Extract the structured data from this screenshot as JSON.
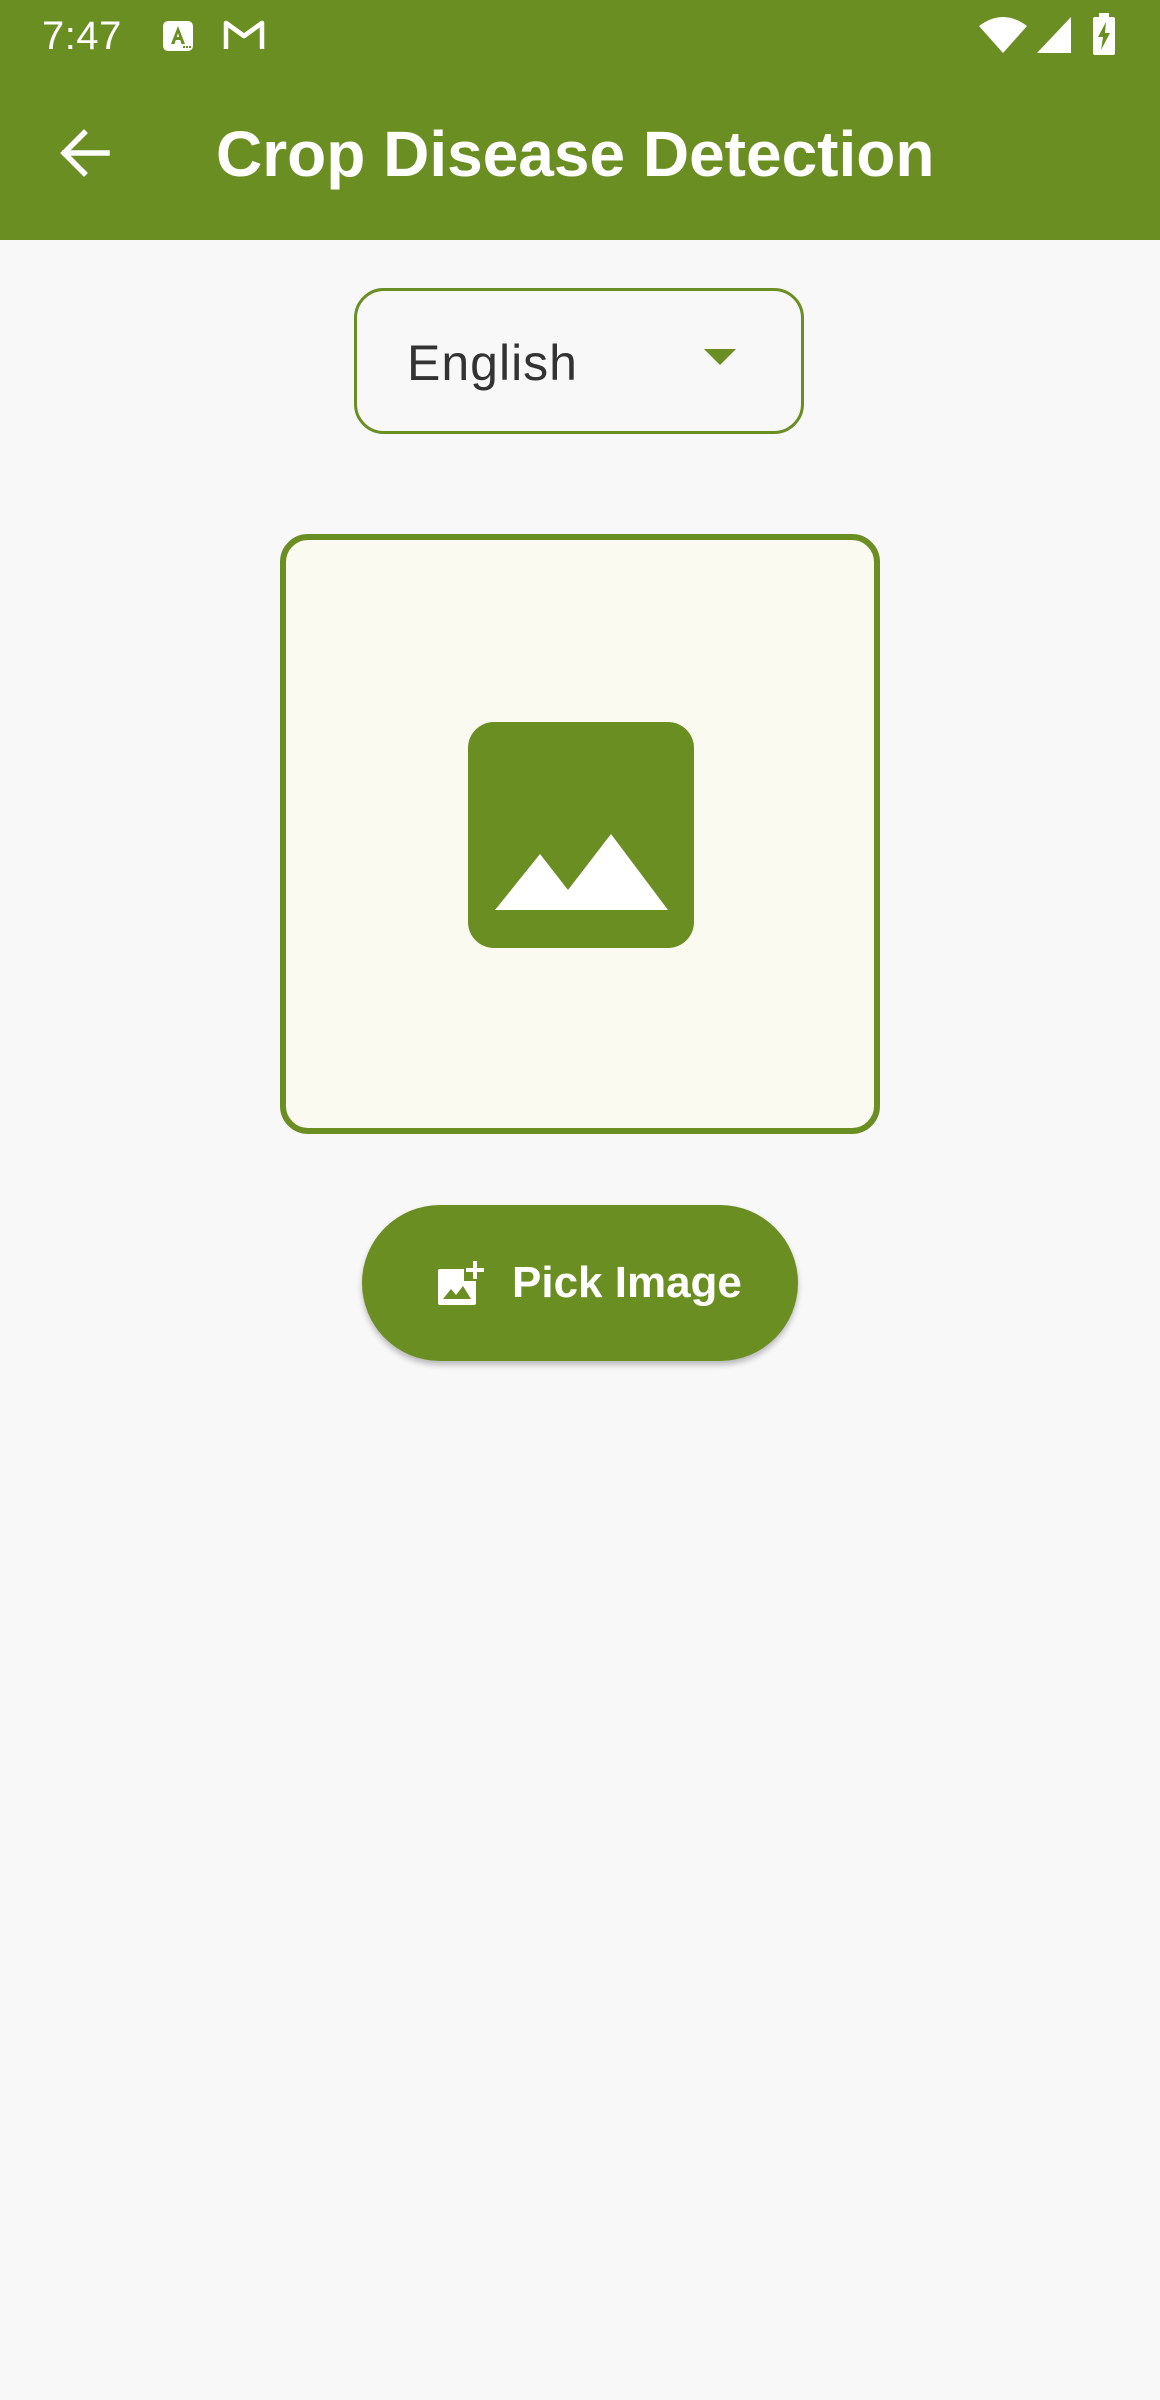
{
  "status_bar": {
    "time": "7:47",
    "left_icons": [
      "translate-icon",
      "gmail-icon"
    ],
    "right_icons": [
      "wifi-icon",
      "cell-signal-icon",
      "battery-charging-icon"
    ]
  },
  "app_bar": {
    "title": "Crop Disease Detection",
    "back_icon": "arrow-back-icon",
    "background_color": "#6b8e23"
  },
  "language_selector": {
    "selected": "English",
    "icon": "dropdown-arrow-icon"
  },
  "image_preview": {
    "placeholder_icon": "image-placeholder-icon",
    "background_color": "#fafaf0"
  },
  "pick_image_button": {
    "label": "Pick Image",
    "icon": "add-photo-icon"
  },
  "colors": {
    "accent": "#6b8e23",
    "background": "#f8f8f8",
    "on_accent": "#ffffff"
  }
}
